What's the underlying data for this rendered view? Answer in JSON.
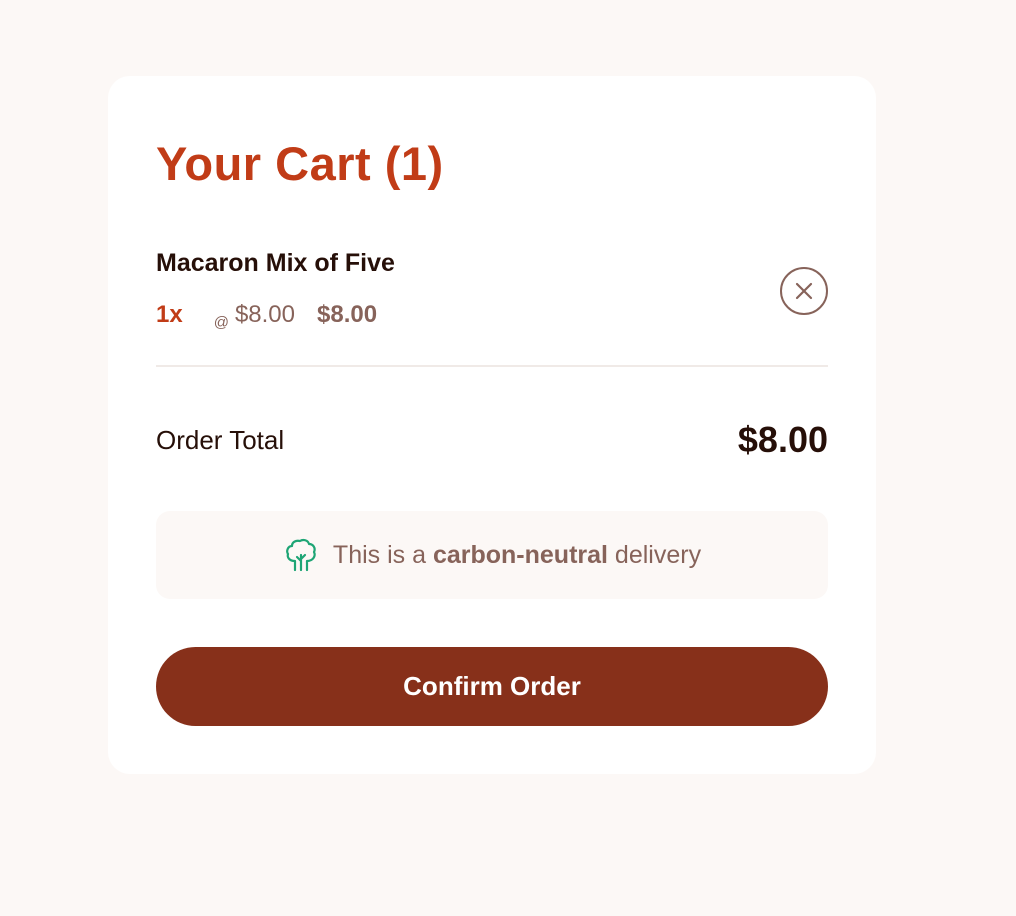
{
  "cart": {
    "title": "Your Cart (1)",
    "items": [
      {
        "name": "Macaron Mix of Five",
        "quantity": "1x",
        "at_symbol": "@",
        "unit_price": "$8.00",
        "subtotal": "$8.00"
      }
    ],
    "remove_icon": "close-circle-icon",
    "order_total_label": "Order Total",
    "order_total_value": "$8.00",
    "carbon_notice": {
      "icon": "tree-icon",
      "prefix": "This is a ",
      "highlight": "carbon-neutral",
      "suffix": " delivery"
    },
    "confirm_label": "Confirm Order"
  },
  "colors": {
    "background": "#fcf8f6",
    "title_red": "#c13c17",
    "text_dark": "#260f08",
    "text_muted": "#87635a",
    "button": "#87301a",
    "tree_green": "#1ea575"
  }
}
